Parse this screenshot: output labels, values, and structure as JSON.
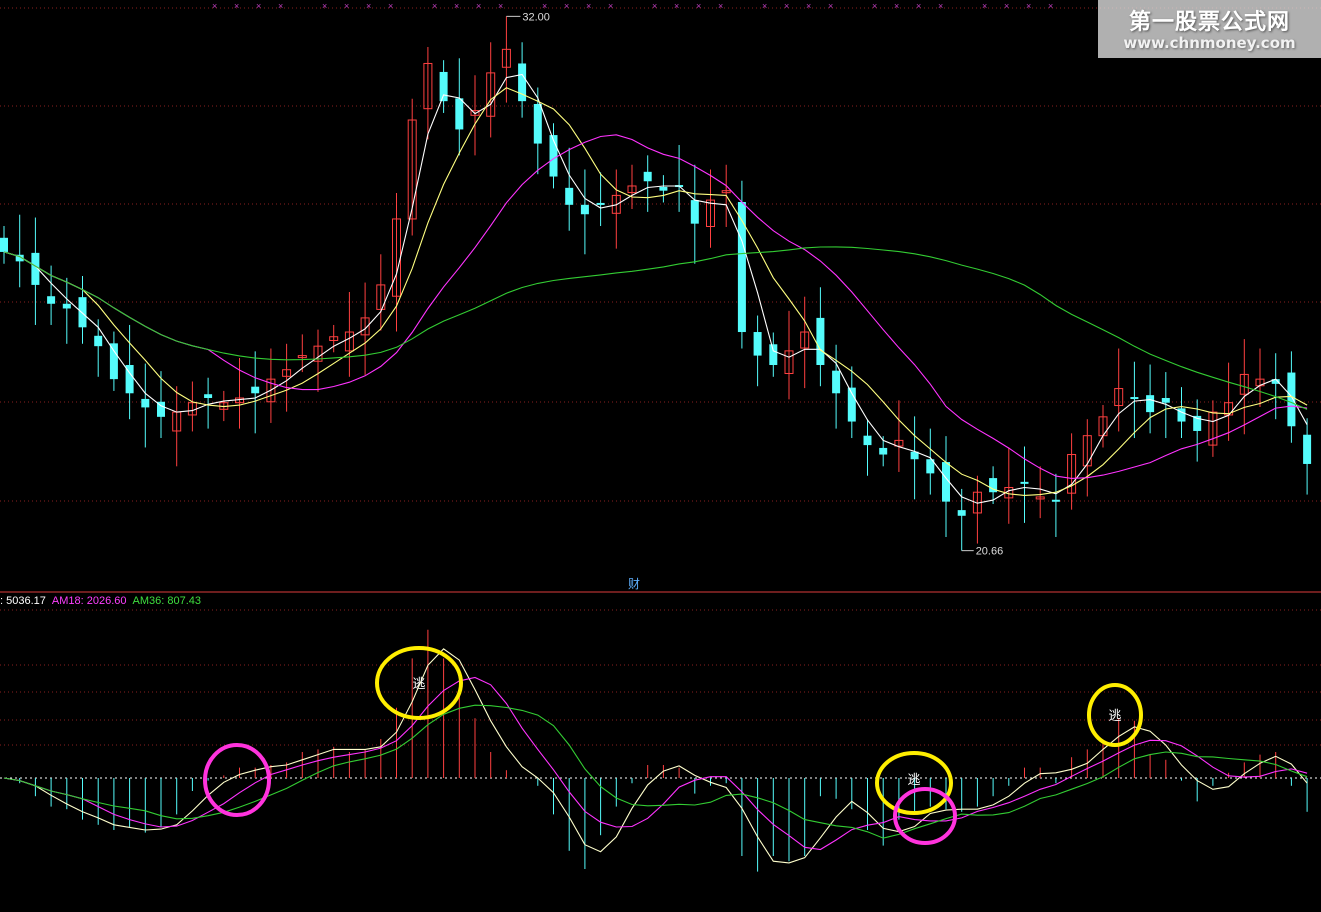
{
  "watermark": {
    "site_name": "第一股票公式网",
    "site_url": "www.chnmoney.com"
  },
  "price_panel": {
    "high_label": "32.00",
    "low_label": "20.66",
    "divider_label": "财"
  },
  "indicator_panel": {
    "legend": [
      {
        "label": ": 5036.17",
        "color": "#ffffff"
      },
      {
        "label": "AM18: 2026.60",
        "color": "#ff3fff"
      },
      {
        "label": "AM36: 807.43",
        "color": "#3fdf3f"
      }
    ],
    "signal_text": "逃",
    "signals": [
      {
        "text": "逃",
        "circle_color": "#ffee00"
      },
      {
        "text": "逃",
        "circle_color": "#ffee00"
      },
      {
        "text": "逃",
        "circle_color": "#ffee00"
      }
    ],
    "highlight_circles": [
      {
        "circle_color": "#ff33dd"
      },
      {
        "circle_color": "#ff33dd"
      }
    ]
  },
  "colors": {
    "background": "#000000",
    "up_candle": "#ff4040",
    "down_candle": "#54fcfc",
    "ma_short": "#ffffff",
    "ma_mid": "#ffff80",
    "ma_long": "#ff33ff",
    "ma_very_long": "#33cc33",
    "grid": "#8a1f1f"
  },
  "chart_data": {
    "type": "candlestick",
    "high": 32.0,
    "low": 20.66,
    "closes": [
      27.0,
      26.8,
      26.3,
      25.9,
      25.8,
      25.4,
      25.0,
      24.3,
      24.0,
      23.7,
      23.5,
      23.6,
      23.8,
      23.9,
      23.8,
      23.9,
      24.0,
      24.3,
      24.5,
      24.8,
      25.0,
      25.2,
      25.3,
      25.6,
      26.3,
      27.7,
      29.8,
      31.0,
      30.2,
      29.6,
      30.0,
      30.8,
      31.3,
      30.2,
      29.3,
      28.6,
      28.0,
      27.8,
      28.0,
      28.2,
      28.4,
      28.5,
      28.3,
      28.4,
      27.6,
      28.1,
      28.3,
      25.3,
      24.8,
      24.6,
      24.9,
      25.3,
      24.6,
      24.0,
      23.4,
      22.9,
      22.7,
      23.0,
      22.6,
      22.3,
      21.7,
      21.4,
      21.9,
      21.9,
      22.0,
      22.1,
      21.8,
      21.7,
      22.7,
      23.1,
      23.5,
      24.1,
      23.9,
      23.6,
      23.8,
      23.4,
      23.2,
      23.6,
      23.8,
      24.4,
      24.3,
      24.2,
      23.3,
      22.5
    ],
    "indicator": {
      "latest_value": 5036.17,
      "AM18": 2026.6,
      "AM36": 807.43
    }
  }
}
